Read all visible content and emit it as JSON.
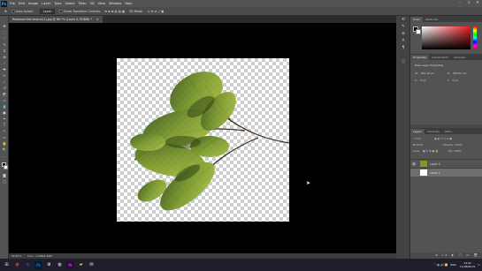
{
  "menubar": {
    "app_icon": "Ps",
    "items": [
      "File",
      "Edit",
      "Image",
      "Layer",
      "Type",
      "Select",
      "Filter",
      "3D",
      "View",
      "Window",
      "Help"
    ]
  },
  "options": {
    "auto_select_label": "Auto-Select:",
    "auto_select_value": "Layer",
    "transform_label": "Show Transform Controls",
    "mode_label": "3D Mode:"
  },
  "document": {
    "tab_title": "Redwood tree branch(1).jpg @ 66.7% (Layer 0, RGB/8) *",
    "close": "×"
  },
  "status": {
    "zoom": "66.67%",
    "doc_info": "Doc: 1.10M/2.44M"
  },
  "panels": {
    "color_tabs": [
      "Color",
      "Swatches"
    ],
    "props_tabs": [
      "Properties",
      "Adjustments",
      "Libraries"
    ],
    "props_title": "Pixel Layer Properties",
    "props_w_label": "W:",
    "props_w_value": "681.49 px",
    "props_h_label": "H:",
    "props_h_value": "660.87 px",
    "props_x_label": "X:",
    "props_x_value": "0 px",
    "props_y_label": "Y:",
    "props_y_value": "0 px",
    "layers_tabs": [
      "Layers",
      "Channels",
      "Paths"
    ],
    "layers_filter": "Kind",
    "blend_mode": "Normal",
    "opacity_label": "Opacity:",
    "opacity_value": "100%",
    "lock_label": "Lock:",
    "fill_label": "Fill:",
    "fill_value": "100%",
    "layers": [
      {
        "name": "Layer 0"
      },
      {
        "name": "Layer 1"
      }
    ],
    "layer_actions": "⊘ fx ◐ ▢ ▭ 🗑"
  },
  "tray": {
    "lang": "ENG",
    "time": "14:42",
    "date": "11/08/2019"
  },
  "colors": {
    "fg": "#000000",
    "bg": "#ffffff",
    "accent": "#31a8ff"
  }
}
